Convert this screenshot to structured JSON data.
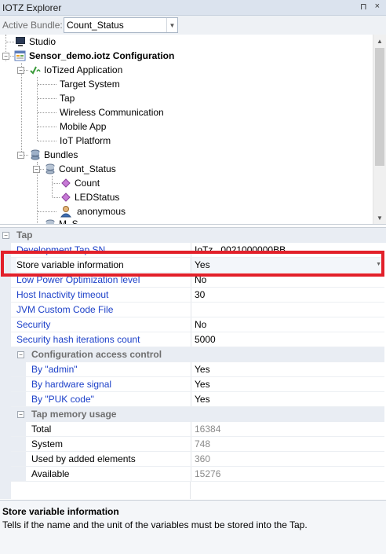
{
  "window": {
    "title": "IOTZ Explorer",
    "pin_glyph": "⊓",
    "close_glyph": "×"
  },
  "bundle": {
    "label": "Active Bundle:",
    "value": "Count_Status",
    "arrow": "▼"
  },
  "tree": {
    "items": [
      {
        "label": "Studio"
      },
      {
        "label": "Sensor_demo.iotz Configuration"
      },
      {
        "label": "IoTized Application"
      },
      {
        "label": "Target System"
      },
      {
        "label": "Tap"
      },
      {
        "label": "Wireless Communication"
      },
      {
        "label": "Mobile App"
      },
      {
        "label": "IoT Platform"
      },
      {
        "label": "Bundles"
      },
      {
        "label": "Count_Status"
      },
      {
        "label": "Count"
      },
      {
        "label": "LEDStatus"
      },
      {
        "label": "anonymous"
      },
      {
        "label": "M_S..."
      }
    ],
    "scroll_up": "▲",
    "scroll_down": "▼"
  },
  "grid": {
    "category": "Tap",
    "rows": [
      {
        "name": "Development Tap SN",
        "value": "IoTz...0021000000BB"
      },
      {
        "name": "Store variable information",
        "value": "Yes"
      },
      {
        "name": "Low Power Optimization level",
        "value": "No"
      },
      {
        "name": "Host Inactivity timeout",
        "value": "30"
      },
      {
        "name": "JVM Custom Code File",
        "value": ""
      },
      {
        "name": "Security",
        "value": "No"
      },
      {
        "name": "Security hash iterations count",
        "value": "5000"
      }
    ],
    "access_category": "Configuration access control",
    "access_rows": [
      {
        "name": "By \"admin\"",
        "value": "Yes"
      },
      {
        "name": "By hardware signal",
        "value": "Yes"
      },
      {
        "name": "By \"PUK code\"",
        "value": "Yes"
      }
    ],
    "memory_category": "Tap memory usage",
    "memory_rows": [
      {
        "name": "Total",
        "value": "16384"
      },
      {
        "name": "System",
        "value": "748"
      },
      {
        "name": "Used by added elements",
        "value": "360"
      },
      {
        "name": "Available",
        "value": "15276"
      }
    ],
    "expander_glyph": "−",
    "dropdown_arrow": "▼"
  },
  "description": {
    "title": "Store variable information",
    "text": "Tells if the name and the unit of the variables must be stored into the Tap."
  },
  "colors": {
    "highlight": "#e2202a",
    "property_name": "#1d41c9",
    "category_bg": "#e9edf3"
  }
}
